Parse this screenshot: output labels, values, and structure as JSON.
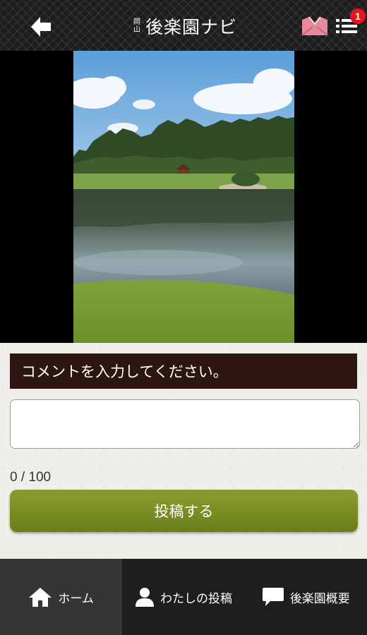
{
  "header": {
    "logo_small_line1": "岡",
    "logo_small_line2": "山",
    "logo_main": "後楽園ナビ",
    "notification_count": "1"
  },
  "form": {
    "prompt": "コメントを入力してください。",
    "comment_value": "",
    "char_count": "0 / 100",
    "submit_label": "投稿する"
  },
  "bottom_nav": {
    "items": [
      {
        "label": "ホーム",
        "icon": "home-icon",
        "active": true
      },
      {
        "label": "わたしの投稿",
        "icon": "person-icon",
        "active": false
      },
      {
        "label": "後楽園概要",
        "icon": "speech-bubble-icon",
        "active": false
      }
    ]
  },
  "colors": {
    "header_bg": "#1d1d1d",
    "prompt_bg": "#2c1513",
    "submit_bg": "#7a8f24",
    "badge": "#e8141c",
    "nav_bg": "#1e1e1e",
    "nav_active_bg": "#353535",
    "letter_icon": "#e98a9c"
  }
}
